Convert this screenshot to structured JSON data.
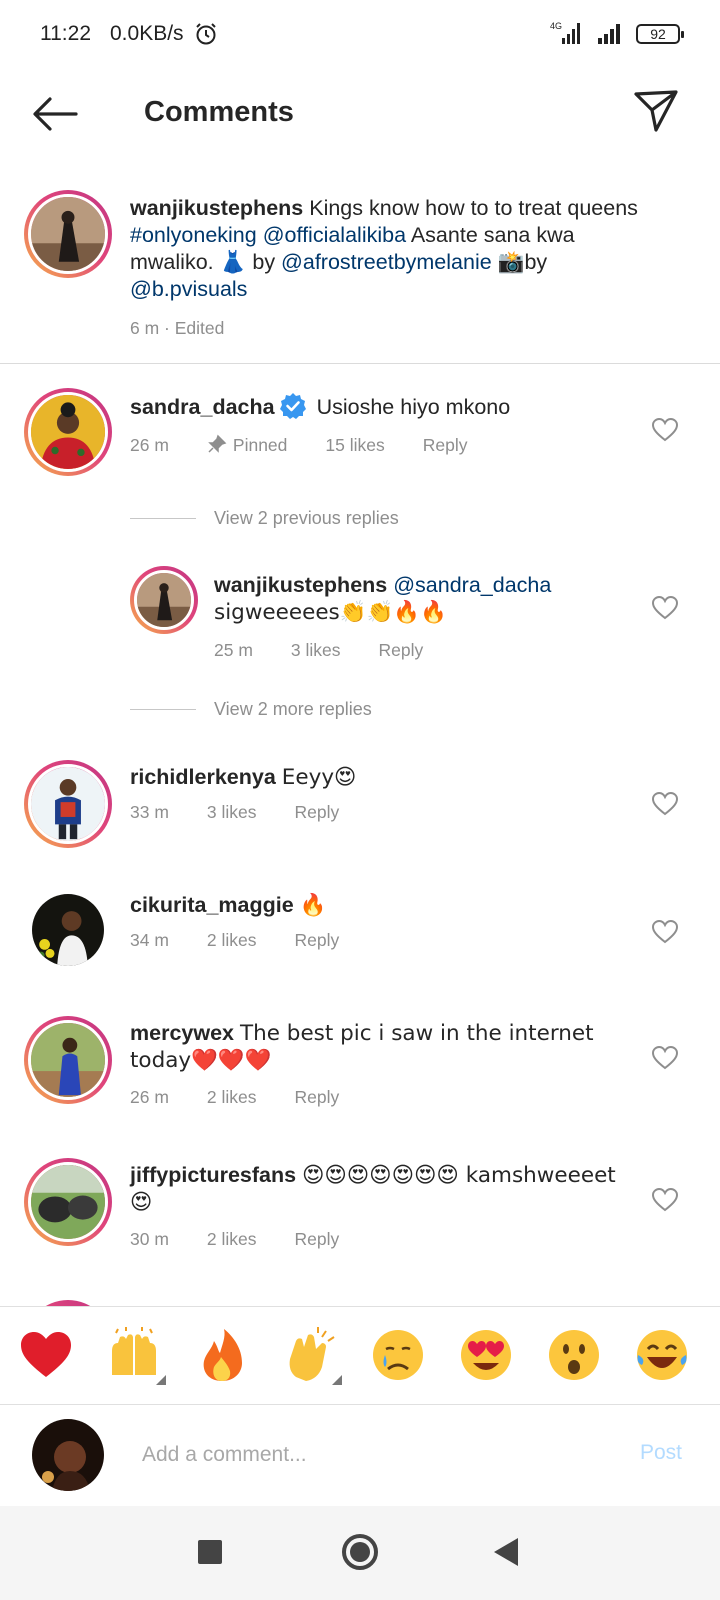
{
  "status_bar": {
    "time": "11:22",
    "speed": "0.0KB/s",
    "network": "4G",
    "battery": "92"
  },
  "header": {
    "title": "Comments"
  },
  "caption": {
    "username": "wanjikustephens",
    "text_1": "Kings  know how to to treat queens ",
    "hashtag": "#onlyoneking",
    "mention_1": "@officialalikiba",
    "text_2": " Asante sana kwa mwaliko. ",
    "emoji_dress": "👗",
    "text_3": " by ",
    "mention_2": "@afrostreetbymelanie",
    "emoji_camera": "📸",
    "text_4": "by ",
    "mention_3": "@b.pvisuals",
    "meta": "6 m · Edited"
  },
  "comments": [
    {
      "username": "sandra_dacha",
      "text": "Usioshe hiyo mkono",
      "time": "26 m",
      "pinned": "Pinned",
      "likes": "15 likes",
      "reply": "Reply"
    },
    {
      "username": "richidlerkenya",
      "text": "Eeyy😍",
      "time": "33 m",
      "likes": "3 likes",
      "reply": "Reply"
    },
    {
      "username": "cikurita_maggie",
      "text": "🔥",
      "time": "34 m",
      "likes": "2 likes",
      "reply": "Reply"
    },
    {
      "username": "mercywex",
      "text": "The best pic i saw in the internet today❤️❤️❤️",
      "time": "26 m",
      "likes": "2 likes",
      "reply": "Reply"
    },
    {
      "username": "jiffypicturesfans",
      "text": "😍😍😍😍😍😍😍 kamshweeeet 😍",
      "time": "30 m",
      "likes": "2 likes",
      "reply": "Reply"
    }
  ],
  "replies": {
    "view_previous": "View 2 previous replies",
    "view_more": "View 2 more replies",
    "reply": {
      "username": "wanjikustephens",
      "mention": "@sandra_dacha",
      "text": "sigweeeees👏👏🔥🔥",
      "time": "25 m",
      "likes": "3 likes",
      "reply": "Reply"
    }
  },
  "emoji_bar": [
    "heart",
    "raising-hands",
    "fire",
    "clapping-hands",
    "crying-face",
    "heart-eyes",
    "surprised-face",
    "laughing-tears"
  ],
  "input": {
    "placeholder": "Add a comment...",
    "post_label": "Post"
  },
  "colors": {
    "mention": "#00376b",
    "meta": "#8e8e8e",
    "post_disabled": "#b3dbff",
    "verified": "#3897f0"
  }
}
